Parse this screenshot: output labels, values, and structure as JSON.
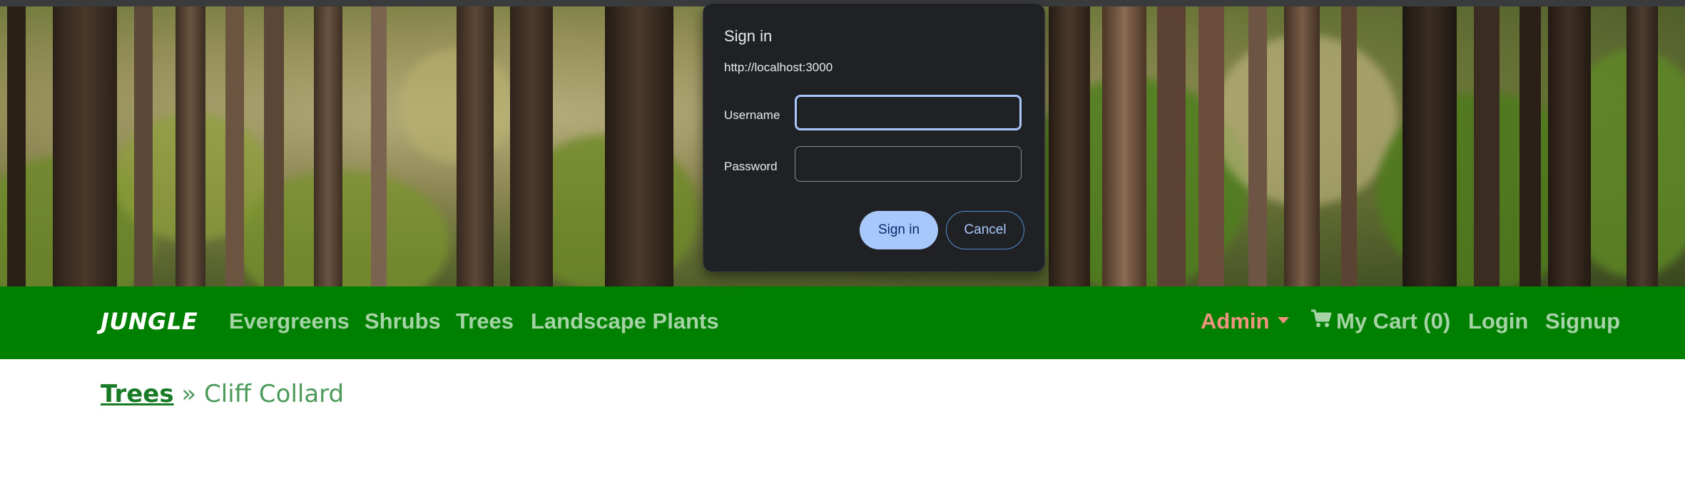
{
  "dialog": {
    "title": "Sign in",
    "origin": "http://localhost:3000",
    "username_label": "Username",
    "username_value": "",
    "password_label": "Password",
    "password_value": "",
    "signin_label": "Sign in",
    "cancel_label": "Cancel"
  },
  "navbar": {
    "brand": "JUNGLE",
    "links": [
      "Evergreens",
      "Shrubs",
      "Trees",
      "Landscape Plants"
    ],
    "admin_label": "Admin",
    "cart_label": "My Cart (0)",
    "login_label": "Login",
    "signup_label": "Signup",
    "colors": {
      "background": "#008000",
      "link": "#a6d3a6",
      "admin": "#f0937e"
    }
  },
  "breadcrumb": {
    "parent": "Trees",
    "separator": "»",
    "current": "Cliff Collard"
  },
  "icons": {
    "cart": "shopping-cart-icon",
    "caret": "caret-down-icon"
  }
}
